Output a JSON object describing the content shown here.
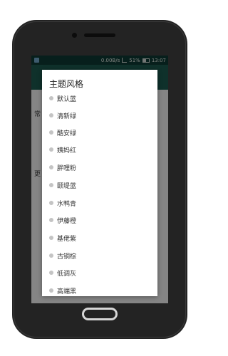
{
  "status_bar": {
    "speed": "0.00B/s",
    "battery": "51%",
    "time": "13:07"
  },
  "background": {
    "frag1": "常",
    "frag2": "更"
  },
  "dialog": {
    "title": "主题风格",
    "options": [
      {
        "label": "默认蓝"
      },
      {
        "label": "清新绿"
      },
      {
        "label": "酷安绿"
      },
      {
        "label": "姨妈红"
      },
      {
        "label": "胖哩粉"
      },
      {
        "label": "颐堤蓝"
      },
      {
        "label": "水鸭青"
      },
      {
        "label": "伊藤橙"
      },
      {
        "label": "基佬紫"
      },
      {
        "label": "古铜棕"
      },
      {
        "label": "低调灰"
      },
      {
        "label": "高端黑"
      }
    ]
  }
}
